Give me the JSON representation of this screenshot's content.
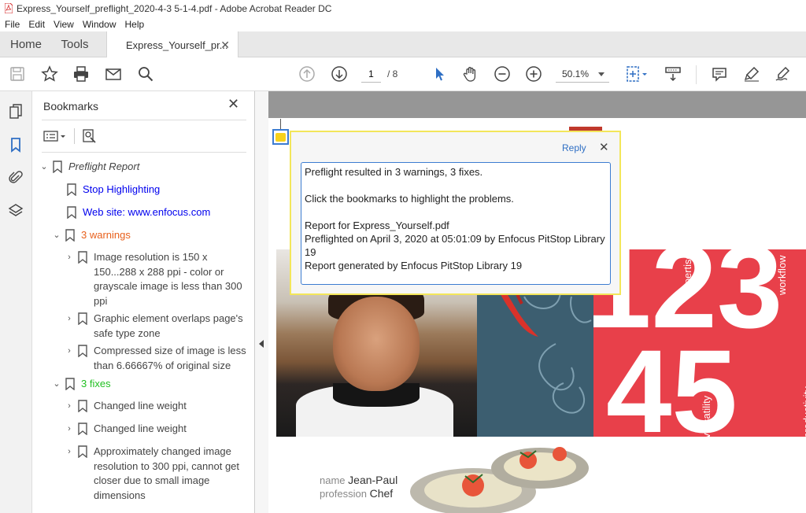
{
  "window": {
    "title": "Express_Yourself_preflight_2020-4-3 5-1-4.pdf - Adobe Acrobat Reader DC"
  },
  "menu": [
    "File",
    "Edit",
    "View",
    "Window",
    "Help"
  ],
  "tabs": {
    "home": "Home",
    "tools": "Tools",
    "document": "Express_Yourself_pr...",
    "close": "✕"
  },
  "toolbar": {
    "page_current": "1",
    "page_total": "/ 8",
    "zoom": "50.1%"
  },
  "bookmarks": {
    "title": "Bookmarks",
    "close": "✕",
    "items": [
      {
        "label": "Preflight Report"
      },
      {
        "label": "Stop Highlighting"
      },
      {
        "label": "Web site: www.enfocus.com"
      },
      {
        "label": "3 warnings"
      },
      {
        "label": "Image resolution is 150 x 150...288 x 288 ppi - color or grayscale image is less than 300 ppi"
      },
      {
        "label": "Graphic element overlaps page's safe type zone"
      },
      {
        "label": "Compressed size of image is less than 6.66667% of original size"
      },
      {
        "label": "3 fixes"
      },
      {
        "label": "Changed line weight"
      },
      {
        "label": "Changed line weight"
      },
      {
        "label": "Approximately changed image resolution to 300 ppi, cannot get closer due to small image dimensions"
      }
    ]
  },
  "comment": {
    "reply": "Reply",
    "close": "✕",
    "lines": [
      "Preflight resulted in 3 warnings, 3 fixes.",
      "Click the bookmarks to highlight the problems.",
      "Report for Express_Yourself.pdf",
      "Preflighted on April 3, 2020 at 05:01:09 by Enfocus PitStop Library 19",
      "Report generated by Enfocus PitStop Library 19"
    ]
  },
  "page": {
    "numbers_top": "123",
    "numbers_bottom": "45",
    "words": [
      "expertise",
      "workflow",
      "versatility",
      "productivity"
    ],
    "name_label": "name",
    "name_value": "Jean-Paul",
    "profession_label": "profession",
    "profession_value": "Chef"
  },
  "colors": {
    "link_blue": "#0000ee",
    "warning_orange": "#e8601c",
    "fixes_green": "#22c022",
    "accent_blue": "#3c7cd1",
    "page_red": "#e8404a"
  }
}
